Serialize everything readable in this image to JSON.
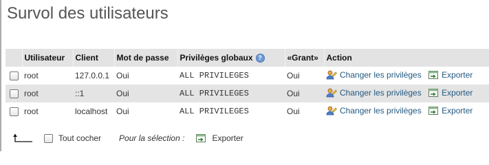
{
  "page": {
    "title": "Survol des utilisateurs"
  },
  "table": {
    "headers": [
      "Utilisateur",
      "Client",
      "Mot de passe",
      "Privilèges globaux",
      "«Grant»",
      "Action"
    ],
    "help_icon_glyph": "?",
    "rows": [
      {
        "user": "root",
        "host": "127.0.0.1",
        "password": "Oui",
        "privileges": "ALL PRIVILEGES",
        "grant": "Oui",
        "edit_label": "Changer les privilèges",
        "export_label": "Exporter"
      },
      {
        "user": "root",
        "host": "::1",
        "password": "Oui",
        "privileges": "ALL PRIVILEGES",
        "grant": "Oui",
        "edit_label": "Changer les privilèges",
        "export_label": "Exporter"
      },
      {
        "user": "root",
        "host": "localhost",
        "password": "Oui",
        "privileges": "ALL PRIVILEGES",
        "grant": "Oui",
        "edit_label": "Changer les privilèges",
        "export_label": "Exporter"
      }
    ]
  },
  "footer": {
    "check_all_label": "Tout cocher",
    "selection_label": "Pour la sélection :",
    "export_label": "Exporter"
  },
  "icons": {
    "edit": "edit-privileges-icon",
    "export": "export-icon",
    "arrow": "arrow-up-left-icon",
    "help": "help-icon"
  },
  "colors": {
    "link": "#235a81",
    "header_bg": "#e3e3e3",
    "row_even_bg": "#e4e4e4",
    "title": "#555555"
  }
}
